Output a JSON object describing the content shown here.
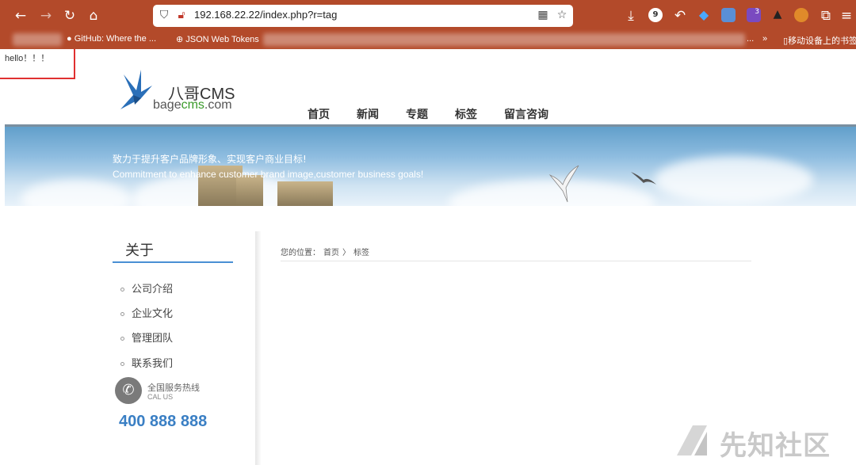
{
  "browser": {
    "url": "192.168.22.22/index.php?r=tag",
    "badge_count_1": "9",
    "badge_count_2": "3"
  },
  "bookmarks": {
    "item_github": "GitHub: Where the ...",
    "item_jwt": "JSON Web Tokens",
    "overflow": "...",
    "mobile_bookmarks": "移动设备上的书签"
  },
  "page": {
    "hello_text": "hello！！！",
    "logo_title": "八哥CMS",
    "logo_domain_prefix": "bage",
    "logo_domain_cms": "cms",
    "logo_domain_suffix": ".com",
    "nav": [
      "首页",
      "新闻",
      "专题",
      "标签",
      "留言咨询"
    ],
    "banner_cn": "致力于提升客户品牌形象、实现客户商业目标!",
    "banner_en": "Commitment to enhance customer brand image,customer business goals!",
    "sidebar_title": "关于",
    "sidebar_items": [
      "公司介绍",
      "企业文化",
      "管理团队",
      "联系我们"
    ],
    "hotline_label": "全国服务热线",
    "hotline_en": "CAL US",
    "phone": "400 888 888",
    "breadcrumb_label": "您的位置：",
    "breadcrumb_home": "首页",
    "breadcrumb_sep": "〉",
    "breadcrumb_current": "标签",
    "watermark": "先知社区"
  },
  "colors": {
    "toolbar": "#b34a2a",
    "accent_blue": "#3a7fc4",
    "logo_green": "#3a9a2a",
    "highlight_red": "#e03030"
  }
}
